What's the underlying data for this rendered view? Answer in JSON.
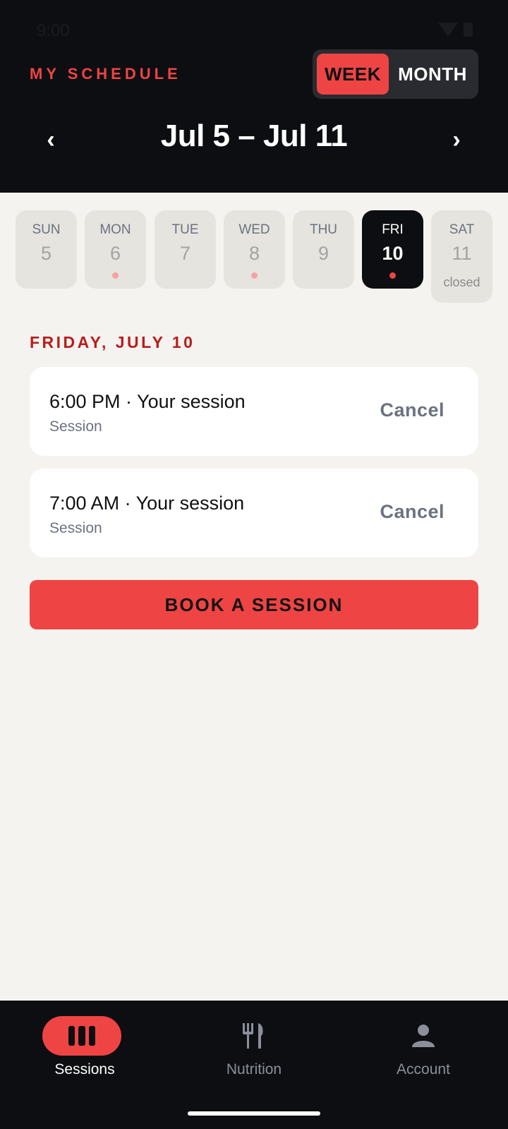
{
  "status_bar": {
    "time": "9:00"
  },
  "header": {
    "title": "MY SCHEDULE",
    "view_toggle": {
      "options": [
        "WEEK",
        "MONTH"
      ],
      "selected": "WEEK"
    },
    "date_range": "Jul 5 – Jul 11",
    "prev_icon": "chevron-left-icon",
    "next_icon": "chevron-right-icon"
  },
  "days": [
    {
      "name": "SUN",
      "num": "5",
      "has_session": false,
      "selected": false,
      "note": ""
    },
    {
      "name": "MON",
      "num": "6",
      "has_session": true,
      "selected": false,
      "note": ""
    },
    {
      "name": "TUE",
      "num": "7",
      "has_session": false,
      "selected": false,
      "note": ""
    },
    {
      "name": "WED",
      "num": "8",
      "has_session": true,
      "selected": false,
      "note": ""
    },
    {
      "name": "THU",
      "num": "9",
      "has_session": false,
      "selected": false,
      "note": ""
    },
    {
      "name": "FRI",
      "num": "10",
      "has_session": true,
      "selected": true,
      "note": ""
    },
    {
      "name": "SAT",
      "num": "11",
      "has_session": false,
      "selected": false,
      "note": "closed"
    }
  ],
  "selected_day_title": "FRIDAY, JULY 10",
  "sessions": [
    {
      "title": "6:00 PM · Your session",
      "subtitle": "Session",
      "action": "Cancel"
    },
    {
      "title": "7:00 AM · Your session",
      "subtitle": "Session",
      "action": "Cancel"
    }
  ],
  "book_button": "BOOK A SESSION",
  "bottom_nav": [
    {
      "label": "Sessions",
      "icon": "sessions-icon",
      "active": true
    },
    {
      "label": "Nutrition",
      "icon": "fork-knife-icon",
      "active": false
    },
    {
      "label": "Account",
      "icon": "person-icon",
      "active": false
    }
  ],
  "colors": {
    "accent": "#ef4444",
    "dark": "#0d0e11",
    "background": "#f4f3ef"
  }
}
